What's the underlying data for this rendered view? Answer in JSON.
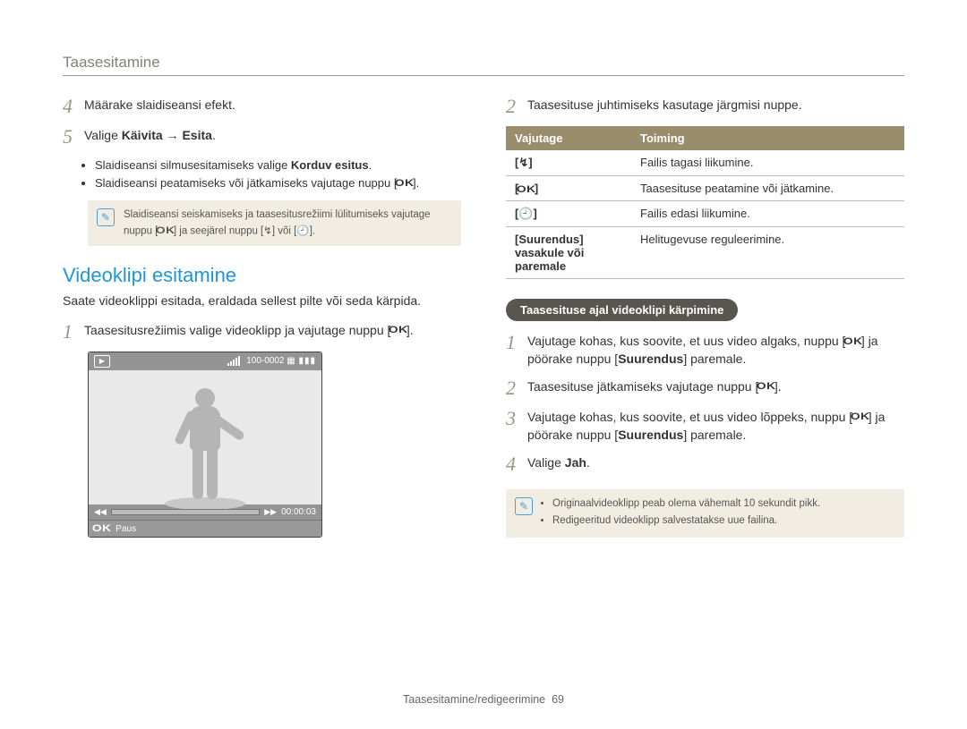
{
  "header": {
    "title": "Taasesitamine"
  },
  "left": {
    "step4": "Määrake slaidiseansi efekt.",
    "step5_pre": "Valige ",
    "step5_bold": "Käivita → Esita",
    "step5_post": ".",
    "bullet1_pre": "Slaidiseansi silmusesitamiseks valige ",
    "bullet1_bold": "Korduv esitus",
    "bullet1_post": ".",
    "bullet2": "Slaidiseansi peatamiseks või jätkamiseks vajutage nuppu [",
    "ok_label": "OK",
    "bullet2_end": "].",
    "note_a": "Slaidiseansi seiskamiseks ja taasesitusrežiimi lülitumiseks vajutage nuppu [",
    "note_b": "] ja seejärel nuppu [",
    "note_flash": "↯",
    "note_c": "] või [",
    "note_timer": "🕘",
    "note_d": "].",
    "section_title": "Videoklipi esitamine",
    "intro": "Saate videoklippi esitada, eraldada sellest pilte või seda kärpida.",
    "play_step1_a": "Taasesitusrežiimis valige videoklipp ja vajutage nuppu [",
    "play_step1_b": "].",
    "screenshot": {
      "counter": "100-0002",
      "time": "00:00:03",
      "paus_label": "Paus",
      "ok": "OK"
    }
  },
  "right": {
    "step2": "Taasesituse juhtimiseks kasutage järgmisi nuppe.",
    "table": {
      "h1": "Vajutage",
      "h2": "Toiming",
      "r1b": "↯",
      "r1t": "Failis tagasi liikumine.",
      "r2b": "OK",
      "r2t": "Taasesituse peatamine või jätkamine.",
      "r3b": "🕘",
      "r3t": "Failis edasi liikumine.",
      "r4b": "[Suurendus] vasakule või paremale",
      "r4t": "Helitugevuse reguleerimine."
    },
    "pill": "Taasesituse ajal videoklipi kärpimine",
    "trim1_a": "Vajutage kohas, kus soovite, et uus video algaks, nuppu [",
    "trim1_b": "] ja pöörake nuppu [",
    "trim1_zoom": "Suurendus",
    "trim1_c": "] paremale.",
    "trim2_a": "Taasesituse jätkamiseks vajutage nuppu [",
    "trim2_b": "].",
    "trim3_a": "Vajutage kohas, kus soovite, et uus video lõppeks, nuppu [",
    "trim3_b": "] ja pöörake nuppu [",
    "trim3_c": "] paremale.",
    "trim4_pre": "Valige ",
    "trim4_bold": "Jah",
    "trim4_post": ".",
    "note_b1": "Originaalvideoklipp peab olema vähemalt 10 sekundit pikk.",
    "note_b2": "Redigeeritud videoklipp salvestatakse uue failina."
  },
  "footer": {
    "text": "Taasesitamine/redigeerimine",
    "page": "69"
  }
}
